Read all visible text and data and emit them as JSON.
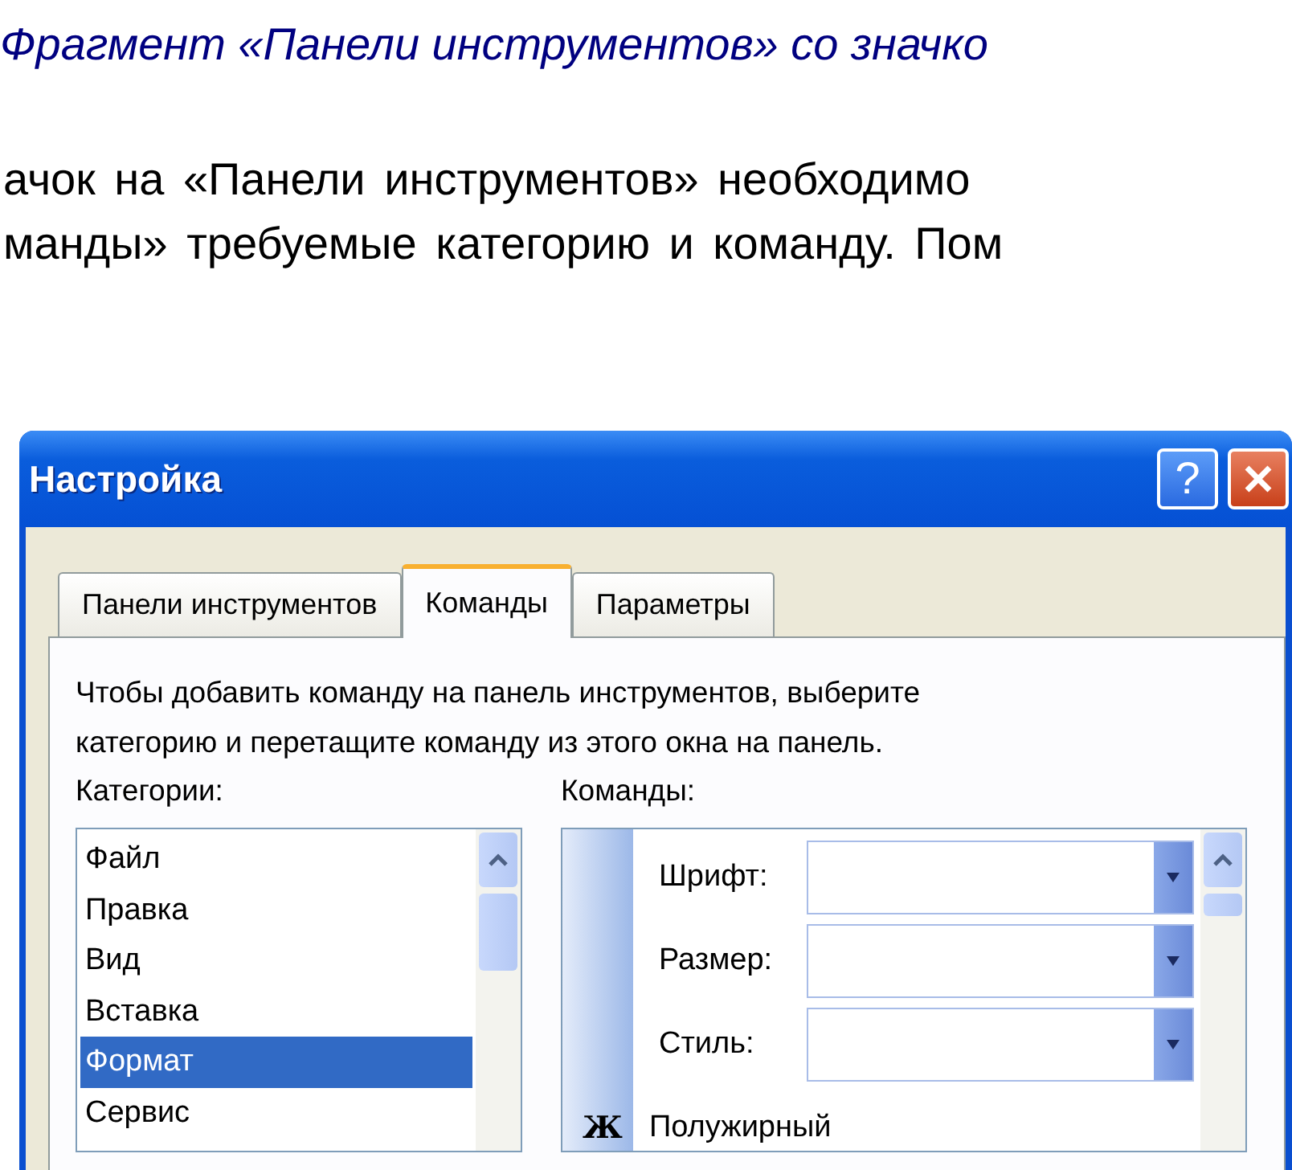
{
  "heading": "Фрагмент «Панели инструментов» со значко",
  "paragraph_lines": [
    "ачок на «Панели инструментов» необходимо",
    "манды» требуемые категорию и команду. Пом"
  ],
  "dialog": {
    "title": "Настройка",
    "help_glyph": "?",
    "tabs": [
      {
        "label": "Панели инструментов",
        "selected": false
      },
      {
        "label": "Команды",
        "selected": true
      },
      {
        "label": "Параметры",
        "selected": false
      }
    ],
    "description": "Чтобы добавить команду на панель инструментов, выберите категорию и перетащите команду из этого окна на панель.",
    "categories_label": "Категории:",
    "commands_label": "Команды:",
    "categories": [
      {
        "label": "Файл",
        "selected": false
      },
      {
        "label": "Правка",
        "selected": false
      },
      {
        "label": "Вид",
        "selected": false
      },
      {
        "label": "Вставка",
        "selected": false
      },
      {
        "label": "Формат",
        "selected": true
      },
      {
        "label": "Сервис",
        "selected": false
      }
    ],
    "commands": [
      {
        "kind": "combo",
        "label": "Шрифт:"
      },
      {
        "kind": "combo",
        "label": "Размер:"
      },
      {
        "kind": "combo",
        "label": "Стиль:"
      },
      {
        "kind": "button",
        "icon_text": "Ж",
        "label": "Полужирный"
      }
    ]
  }
}
